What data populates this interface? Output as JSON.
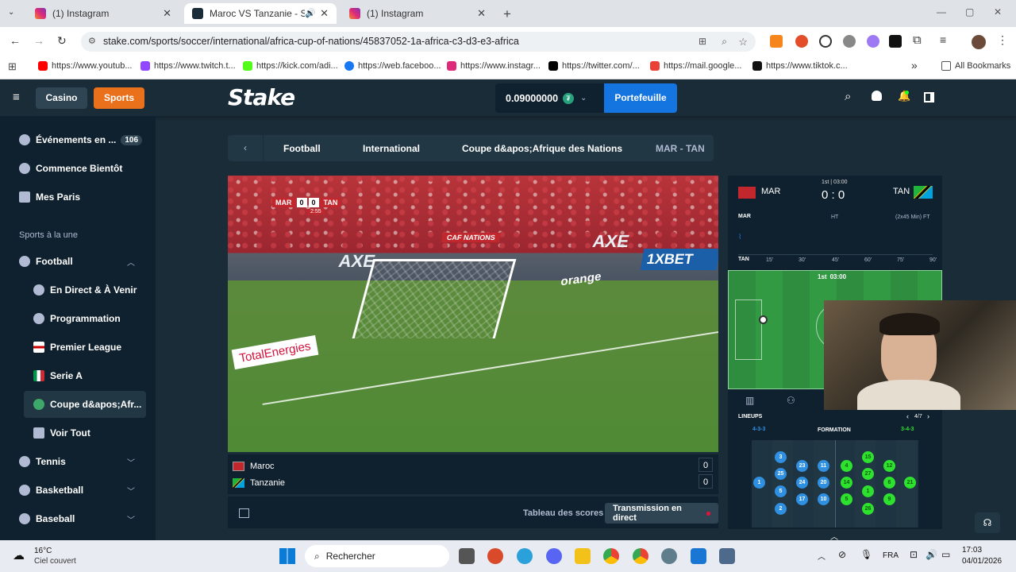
{
  "browser": {
    "tabs": [
      {
        "title": "(1) Instagram",
        "active": false
      },
      {
        "title": "Maroc VS Tanzanie - Stake.c",
        "active": true
      },
      {
        "title": "(1) Instagram",
        "active": false
      }
    ],
    "new_tab": "+",
    "url": "stake.com/sports/soccer/international/africa-cup-of-nations/45837052-1a-africa-c3-d3-e3-africa",
    "bookmarks": [
      "https://www.youtub...",
      "https://www.twitch.t...",
      "https://kick.com/adi...",
      "https://web.faceboo...",
      "https://www.instagr...",
      "https://twitter.com/...",
      "https://mail.google...",
      "https://www.tiktok.c..."
    ],
    "all_bookmarks": "All Bookmarks",
    "chevron": "»"
  },
  "stake": {
    "casino": "Casino",
    "sports": "Sports",
    "logo": "Stake",
    "balance": "0.09000000",
    "wallet": "Portefeuille"
  },
  "sidebar": {
    "live_events": "Événements en ...",
    "live_count": "106",
    "starting_soon": "Commence Bientôt",
    "my_bets": "Mes Paris",
    "section": "Sports à la une",
    "football": "Football",
    "football_sub": [
      "En Direct & À Venir",
      "Programmation",
      "Premier League",
      "Serie A",
      "Coupe d&apos;Afr...",
      "Voir Tout"
    ],
    "tennis": "Tennis",
    "basketball": "Basketball",
    "baseball": "Baseball"
  },
  "breadcrumb": [
    "Football",
    "International",
    "Coupe d&apos;Afrique des Nations",
    "MAR - TAN"
  ],
  "video_overlay": {
    "home": "MAR",
    "home_score": "0",
    "away_score": "0",
    "away": "TAN",
    "clock": "2:55",
    "ads": [
      "AXE",
      "orange",
      "1XBET",
      "TotalEnergies",
      "CAF NATIONS"
    ]
  },
  "scoreboard": {
    "teams": [
      {
        "name": "Maroc",
        "score": "0"
      },
      {
        "name": "Tanzanie",
        "score": "0"
      }
    ],
    "tab_scores": "Tableau des scores",
    "tab_live": "Transmission en direct"
  },
  "match_tracker": {
    "home": "MAR",
    "away": "TAN",
    "period": "1st | 03:00",
    "score": "0 : 0",
    "timeline_home": "MAR",
    "timeline_away": "TAN",
    "ht": "HT",
    "ft": "(2x45 Min) FT",
    "ticks": [
      "15'",
      "30'",
      "45'",
      "60'",
      "75'",
      "90'"
    ],
    "pitch_label_period": "1st",
    "pitch_label_time": "03:00",
    "lineups": "LINEUPS",
    "page": "4/7",
    "formation_label": "FORMATION",
    "home_formation": "4-3-3",
    "away_formation": "3-4-3",
    "home_players": [
      "1",
      "3",
      "25",
      "5",
      "2",
      "23",
      "24",
      "17",
      "11",
      "20",
      "10"
    ],
    "away_players": [
      "4",
      "15",
      "12",
      "27",
      "14",
      "6",
      "21",
      "1",
      "5",
      "26",
      "9"
    ]
  },
  "taskbar": {
    "weather_temp": "16°C",
    "weather_desc": "Ciel couvert",
    "search": "Rechercher",
    "lang": "FRA",
    "time": "17:03",
    "date": "04/01/2026"
  },
  "colors": {
    "stake_bg": "#1a2c38",
    "panel": "#0f212e",
    "accent_blue": "#1475e1",
    "sports_orange": "#e9711c",
    "live_red": "#e9113c"
  }
}
